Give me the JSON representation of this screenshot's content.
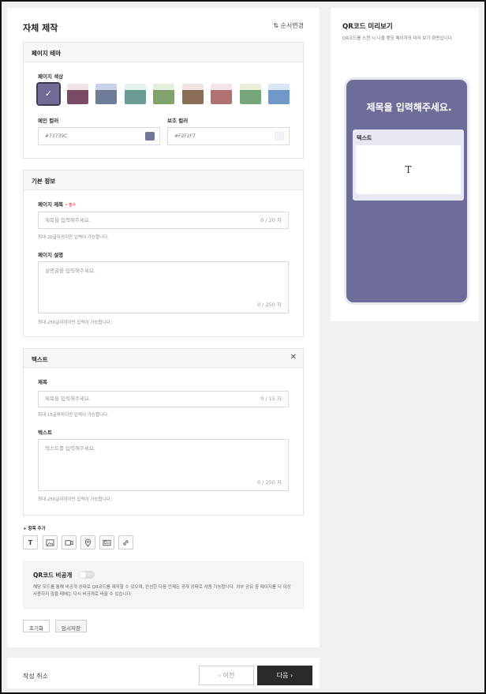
{
  "header": {
    "title": "자체 제작",
    "order_label": "⇅ 순서변경"
  },
  "theme": {
    "title": "페이지 테마",
    "color_label": "페이지 색상",
    "selected_check": "✓",
    "swatches": [
      {
        "top": "#6f6d98",
        "bottom": "#6f6d98",
        "selected": true
      },
      {
        "top": "#f1e4e8",
        "bottom": "#7b4b63"
      },
      {
        "top": "#c8d2e8",
        "bottom": "#6f7d99"
      },
      {
        "top": "#e4f1ee",
        "bottom": "#6b9c93"
      },
      {
        "top": "#e5efe0",
        "bottom": "#83a16c"
      },
      {
        "top": "#f0e4e2",
        "bottom": "#8a6f56"
      },
      {
        "top": "#f6e5e6",
        "bottom": "#b07271"
      },
      {
        "top": "#e9efd8",
        "bottom": "#75a77a"
      },
      {
        "top": "#d9e6f3",
        "bottom": "#6f98c9"
      }
    ],
    "main_color_label": "메인 컬러",
    "main_color_value": "#73739C",
    "main_color_hex": "#73739C",
    "sub_color_label": "보조 컬러",
    "sub_color_value": "#F2F2F7",
    "sub_color_hex": "#F2F2F7"
  },
  "basic": {
    "title": "기본 정보",
    "page_title_label": "페이지 제목",
    "required": "• 필수",
    "page_title_placeholder": "제목을 입력해주세요.",
    "page_title_count": "0 / 20 자",
    "page_title_help": "최대 20글자까지만 입력이 가능합니다.",
    "desc_label": "페이지 설명",
    "desc_placeholder": "설명글을 입력해주세요.",
    "desc_count": "0 / 250 자",
    "desc_help": "최대 250글자까지만 입력이 가능합니다."
  },
  "text_block": {
    "title": "텍스트",
    "close": "✕",
    "title_label": "제목",
    "title_placeholder": "제목을 입력해주세요.",
    "title_count": "0 / 15 자",
    "title_help": "최대 15글자까지만 입력이 가능합니다.",
    "text_label": "텍스트",
    "text_placeholder": "텍스트를 입력해주세요.",
    "text_count": "0 / 250 자",
    "text_help": "최대 250글자까지만 입력이 가능합니다."
  },
  "add_item": {
    "label": "+ 항목 추가",
    "text_tool": "T",
    "tools": [
      "text-tool-icon",
      "image-icon",
      "video-icon",
      "location-pin-icon",
      "card-icon",
      "link-icon"
    ]
  },
  "qr_private": {
    "title": "QR코드 비공개",
    "toggle_text": "OFF",
    "description": "해당 모드를 통해 비공개 상태로 QR코드를 제작할 수 있으며, 완성한 다음 언제든 공개 상태로 사용 가능합니다. 외부 공유 중 페이지를 더 이상 사용하지 않을 때에는 다시 비공개로 바꿀 수 있습니다."
  },
  "actions": {
    "reset": "초기화",
    "temp_save": "임시저장"
  },
  "preview": {
    "title": "QR코드 미리보기",
    "description": "QR코드를 스캔 시 나올 랜딩 페이지의 미리 보기 화면입니다.",
    "phone_title": "제목을 입력해주세요.",
    "card_label": "텍스트",
    "card_icon": "T"
  },
  "footer": {
    "cancel": "작성 취소",
    "prev": "‹  이전",
    "next": "다음  ›"
  }
}
